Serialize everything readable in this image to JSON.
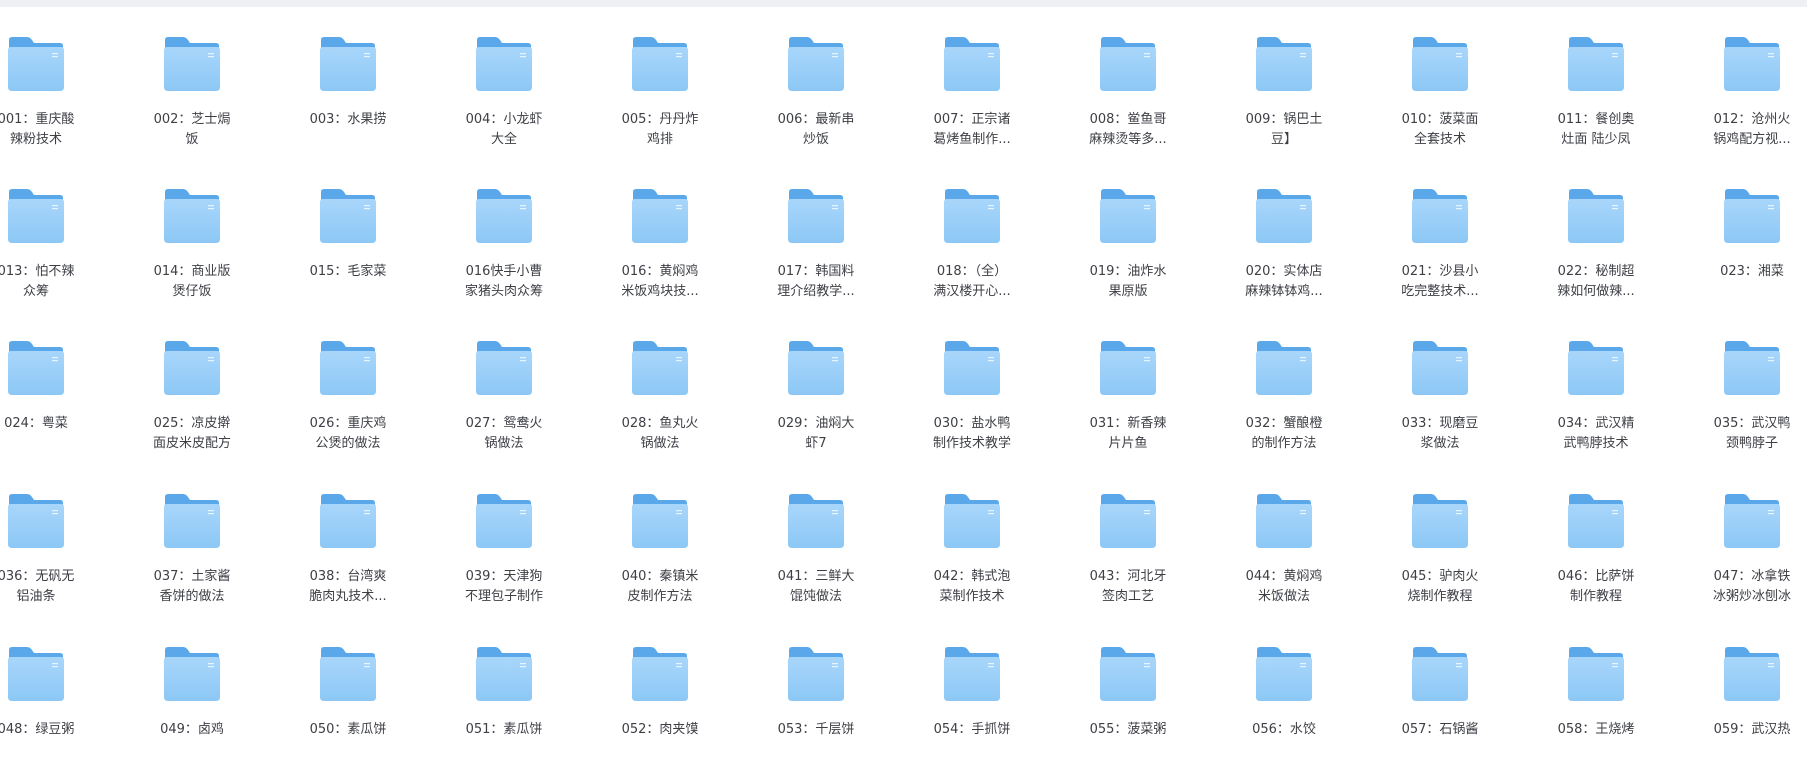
{
  "folders": [
    {
      "line1": "001：重庆酸",
      "line2": "辣粉技术"
    },
    {
      "line1": "002：芝士焗",
      "line2": "饭"
    },
    {
      "line1": "003：水果捞",
      "line2": ""
    },
    {
      "line1": "004：小龙虾",
      "line2": "大全"
    },
    {
      "line1": "005：丹丹炸",
      "line2": "鸡排"
    },
    {
      "line1": "006：最新串",
      "line2": "炒饭"
    },
    {
      "line1": "007：正宗诸",
      "line2": "葛烤鱼制作..."
    },
    {
      "line1": "008：鲎鱼哥",
      "line2": "麻辣烫等多..."
    },
    {
      "line1": "009：锅巴土",
      "line2": "豆】"
    },
    {
      "line1": "010：菠菜面",
      "line2": "全套技术"
    },
    {
      "line1": "011：餐创奥",
      "line2": "灶面 陆少凤"
    },
    {
      "line1": "012：沧州火",
      "line2": "锅鸡配方视..."
    },
    {
      "line1": "013：怕不辣",
      "line2": "众筹"
    },
    {
      "line1": "014：商业版",
      "line2": "煲仔饭"
    },
    {
      "line1": "015：毛家菜",
      "line2": ""
    },
    {
      "line1": "016快手小曹",
      "line2": "家猪头肉众筹"
    },
    {
      "line1": "016：黄焖鸡",
      "line2": "米饭鸡块技..."
    },
    {
      "line1": "017：韩国料",
      "line2": "理介绍教学..."
    },
    {
      "line1": "018：（全）",
      "line2": "满汉楼开心..."
    },
    {
      "line1": "019：油炸水",
      "line2": "果原版"
    },
    {
      "line1": "020：实体店",
      "line2": "麻辣钵钵鸡..."
    },
    {
      "line1": "021：沙县小",
      "line2": "吃完整技术..."
    },
    {
      "line1": "022：秘制超",
      "line2": "辣如何做辣..."
    },
    {
      "line1": "023：湘菜",
      "line2": ""
    },
    {
      "line1": "024：粤菜",
      "line2": ""
    },
    {
      "line1": "025：凉皮擀",
      "line2": "面皮米皮配方"
    },
    {
      "line1": "026：重庆鸡",
      "line2": "公煲的做法"
    },
    {
      "line1": "027：鸳鸯火",
      "line2": "锅做法"
    },
    {
      "line1": "028：鱼丸火",
      "line2": "锅做法"
    },
    {
      "line1": "029：油焖大",
      "line2": "虾7"
    },
    {
      "line1": "030：盐水鸭",
      "line2": "制作技术教学"
    },
    {
      "line1": "031：新香辣",
      "line2": "片片鱼"
    },
    {
      "line1": "032：蟹酿橙",
      "line2": "的制作方法"
    },
    {
      "line1": "033：现磨豆",
      "line2": "浆做法"
    },
    {
      "line1": "034：武汉精",
      "line2": "武鸭脖技术"
    },
    {
      "line1": "035：武汉鸭",
      "line2": "颈鸭脖子"
    },
    {
      "line1": "036：无矾无",
      "line2": "铝油条"
    },
    {
      "line1": "037：土家酱",
      "line2": "香饼的做法"
    },
    {
      "line1": "038：台湾爽",
      "line2": "脆肉丸技术..."
    },
    {
      "line1": "039：天津狗",
      "line2": "不理包子制作"
    },
    {
      "line1": "040：秦镇米",
      "line2": "皮制作方法"
    },
    {
      "line1": "041：三鲜大",
      "line2": "馄饨做法"
    },
    {
      "line1": "042：韩式泡",
      "line2": "菜制作技术"
    },
    {
      "line1": "043：河北牙",
      "line2": "签肉工艺"
    },
    {
      "line1": "044：黄焖鸡",
      "line2": "米饭做法"
    },
    {
      "line1": "045：驴肉火",
      "line2": "烧制作教程"
    },
    {
      "line1": "046：比萨饼",
      "line2": "制作教程"
    },
    {
      "line1": "047：冰拿铁",
      "line2": "冰粥炒冰刨冰"
    },
    {
      "line1": "048：绿豆粥",
      "line2": ""
    },
    {
      "line1": "049：卤鸡",
      "line2": ""
    },
    {
      "line1": "050：素瓜饼",
      "line2": ""
    },
    {
      "line1": "051：素瓜饼",
      "line2": ""
    },
    {
      "line1": "052：肉夹馍",
      "line2": ""
    },
    {
      "line1": "053：千层饼",
      "line2": ""
    },
    {
      "line1": "054：手抓饼",
      "line2": ""
    },
    {
      "line1": "055：菠菜粥",
      "line2": ""
    },
    {
      "line1": "056：水饺",
      "line2": ""
    },
    {
      "line1": "057：石锅酱",
      "line2": ""
    },
    {
      "line1": "058：王烧烤",
      "line2": ""
    },
    {
      "line1": "059：武汉热",
      "line2": ""
    }
  ],
  "colors": {
    "folder_back": "#5aa8ea",
    "folder_front": "#8cc8f6",
    "folder_front_light": "#a9d6fa",
    "label": "#3d3f45",
    "top_strip": "#eef0f4"
  },
  "icon": "folder-icon"
}
